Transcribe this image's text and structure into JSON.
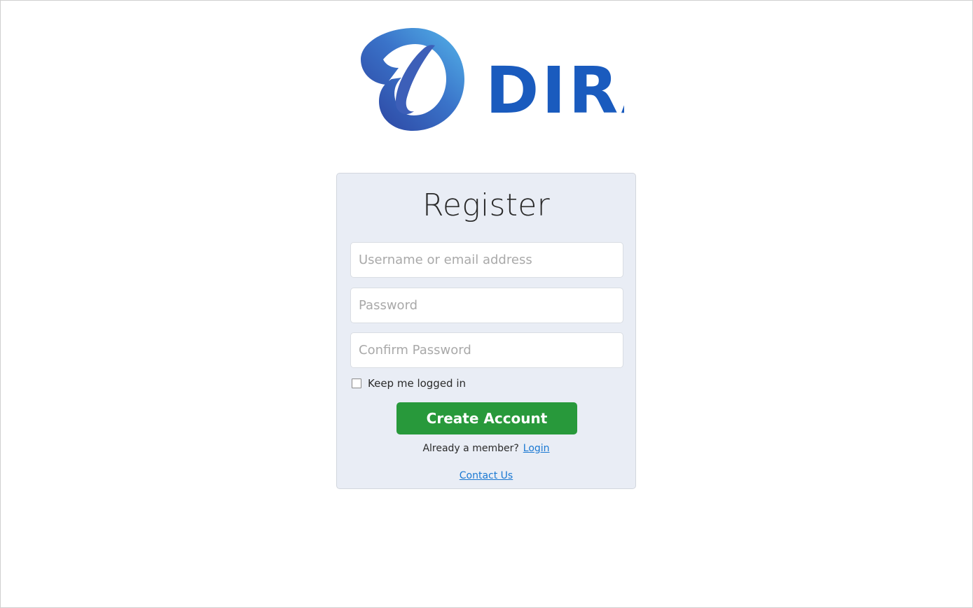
{
  "brand": {
    "name": "DIRA",
    "colors": {
      "primary": "#1a5bbe",
      "gradient_dark": "#2b3f9c",
      "gradient_light": "#55b6ea"
    }
  },
  "form": {
    "title": "Register",
    "username_placeholder": "Username or email address",
    "password_placeholder": "Password",
    "confirm_placeholder": "Confirm Password",
    "remember_label": "Keep me logged in",
    "submit_label": "Create Account",
    "member_prompt": "Already a member?",
    "login_link": "Login",
    "contact_link": "Contact Us"
  },
  "colors": {
    "card_background": "#e9edf5",
    "button": "#28993b",
    "link": "#1a78d2"
  }
}
